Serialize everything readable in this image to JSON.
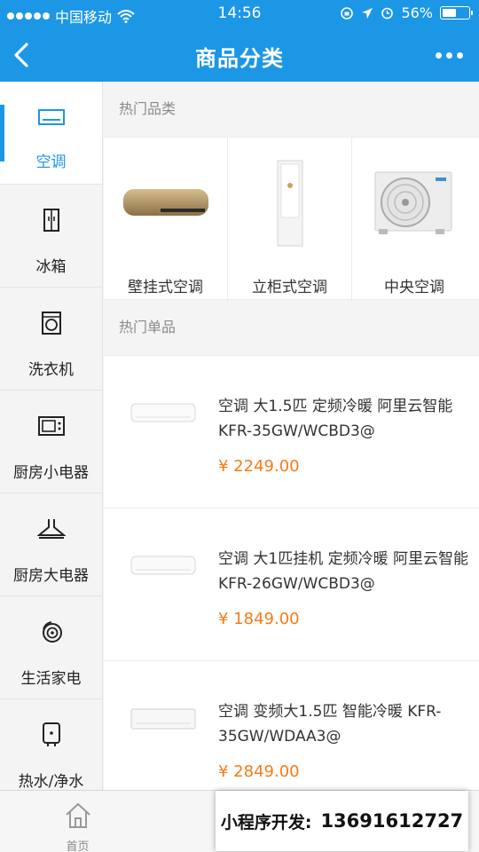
{
  "status_bar": {
    "carrier": "中国移动",
    "time": "14:56",
    "battery": "56%",
    "battery_level": 0.56
  },
  "nav": {
    "title": "商品分类",
    "back_icon": "chevron-left-icon",
    "more_icon": "more-dots-icon"
  },
  "sidebar": {
    "items": [
      {
        "label": "空调",
        "icon": "air-conditioner-icon",
        "active": true
      },
      {
        "label": "冰箱",
        "icon": "fridge-icon"
      },
      {
        "label": "洗衣机",
        "icon": "washer-icon"
      },
      {
        "label": "厨房小电器",
        "icon": "microwave-icon"
      },
      {
        "label": "厨房大电器",
        "icon": "range-hood-icon"
      },
      {
        "label": "生活家电",
        "icon": "fan-icon"
      },
      {
        "label": "热水/净水",
        "icon": "water-heater-icon"
      }
    ]
  },
  "main": {
    "hot_categories_title": "热门品类",
    "categories": [
      {
        "label": "壁挂式空调"
      },
      {
        "label": "立柜式空调"
      },
      {
        "label": "中央空调"
      }
    ],
    "hot_products_title": "热门单品",
    "products": [
      {
        "name": "空调 大1.5匹 定频冷暖 阿里云智能 KFR-35GW/WCBD3@",
        "price": "¥ 2249.00"
      },
      {
        "name": "空调 大1匹挂机 定频冷暖 阿里云智能 KFR-26GW/WCBD3@",
        "price": "¥ 1849.00"
      },
      {
        "name": "空调 变频大1.5匹 智能冷暖 KFR-35GW/WDAA3@",
        "price": "¥ 2849.00"
      }
    ]
  },
  "tabbar": {
    "tabs": [
      {
        "label": "首页",
        "icon": "home-icon"
      }
    ]
  },
  "promo": {
    "label": "小程序开发:",
    "phone": "13691612727"
  },
  "colors": {
    "brand": "#1c97e6",
    "price": "#f97a17"
  }
}
